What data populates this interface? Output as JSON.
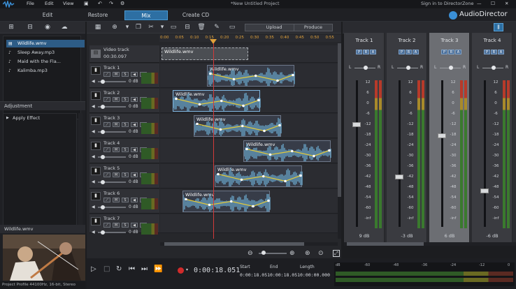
{
  "app": {
    "title": "*New Untitled Project",
    "menus": [
      "File",
      "Edit",
      "View"
    ],
    "directorzone": "Sign in to DirectorZone",
    "brand": "AudioDirector"
  },
  "tabs": [
    {
      "label": "Edit"
    },
    {
      "label": "Restore"
    },
    {
      "label": "Mix"
    },
    {
      "label": "Create CD"
    }
  ],
  "library": {
    "items": [
      "Wildlife.wmv",
      "Sleep Away.mp3",
      "Maid with the Fla...",
      "Kalimba.mp3"
    ]
  },
  "adjustment": {
    "title": "Adjustment",
    "apply_effect": "Apply Effect"
  },
  "preview": {
    "title": "Wildlife.wmv"
  },
  "toolbar": {
    "upload": "Upload",
    "produce": "Produce"
  },
  "ruler": [
    "0:00",
    "0:05",
    "0:10",
    "0:15",
    "0:20",
    "0:25",
    "0:30",
    "0:35",
    "0:40",
    "0:45",
    "0:50",
    "0:55"
  ],
  "video_track": {
    "label": "Video track",
    "duration": "00:30.097",
    "clip": "Wildlife.wmv"
  },
  "tracks": [
    {
      "name": "Track 1",
      "db": "0 dB",
      "clip": "Wildlife.wmv"
    },
    {
      "name": "Track 2",
      "db": "0 dB",
      "clip": "Wildlife.wmv"
    },
    {
      "name": "Track 3",
      "db": "0 dB",
      "clip": "Wildlife.wmv"
    },
    {
      "name": "Track 4",
      "db": "0 dB",
      "clip": "Wildlife.wmv"
    },
    {
      "name": "Track 5",
      "db": "0 dB",
      "clip": "Wildlife.wmv"
    },
    {
      "name": "Track 6",
      "db": "0 dB",
      "clip": "Wildlife.wmv"
    },
    {
      "name": "Track 7",
      "db": "0 dB",
      "clip": ""
    }
  ],
  "mixer": {
    "strips": [
      {
        "name": "Track 1",
        "value": "9 dB"
      },
      {
        "name": "Track 2",
        "value": "-3 dB"
      },
      {
        "name": "Track 3",
        "value": "6 dB"
      },
      {
        "name": "Track 4",
        "value": "-6 dB"
      }
    ],
    "scale": [
      "12",
      "6",
      "0",
      "-6",
      "-12",
      "-18",
      "-24",
      "-30",
      "-36",
      "-42",
      "-48",
      "-54",
      "-60",
      "-inf"
    ]
  },
  "transport": {
    "timecode": "0:00:18.051",
    "start_label": "Start",
    "start": "0:00:18.051",
    "end_label": "End",
    "end": "0:00:18.051",
    "length_label": "Length",
    "length": "0:00:00.000",
    "meter_scale": [
      "dB",
      "-60",
      "-48",
      "-36",
      "-24",
      "-12",
      "0"
    ]
  },
  "status": "Project Profile 44100Hz, 16-bit, Stereo",
  "colors": {
    "accent": "#2d6fa3",
    "waveform": "#6fb0d6",
    "envelope": "#e3c93a",
    "playhead": "#d23a3a"
  }
}
